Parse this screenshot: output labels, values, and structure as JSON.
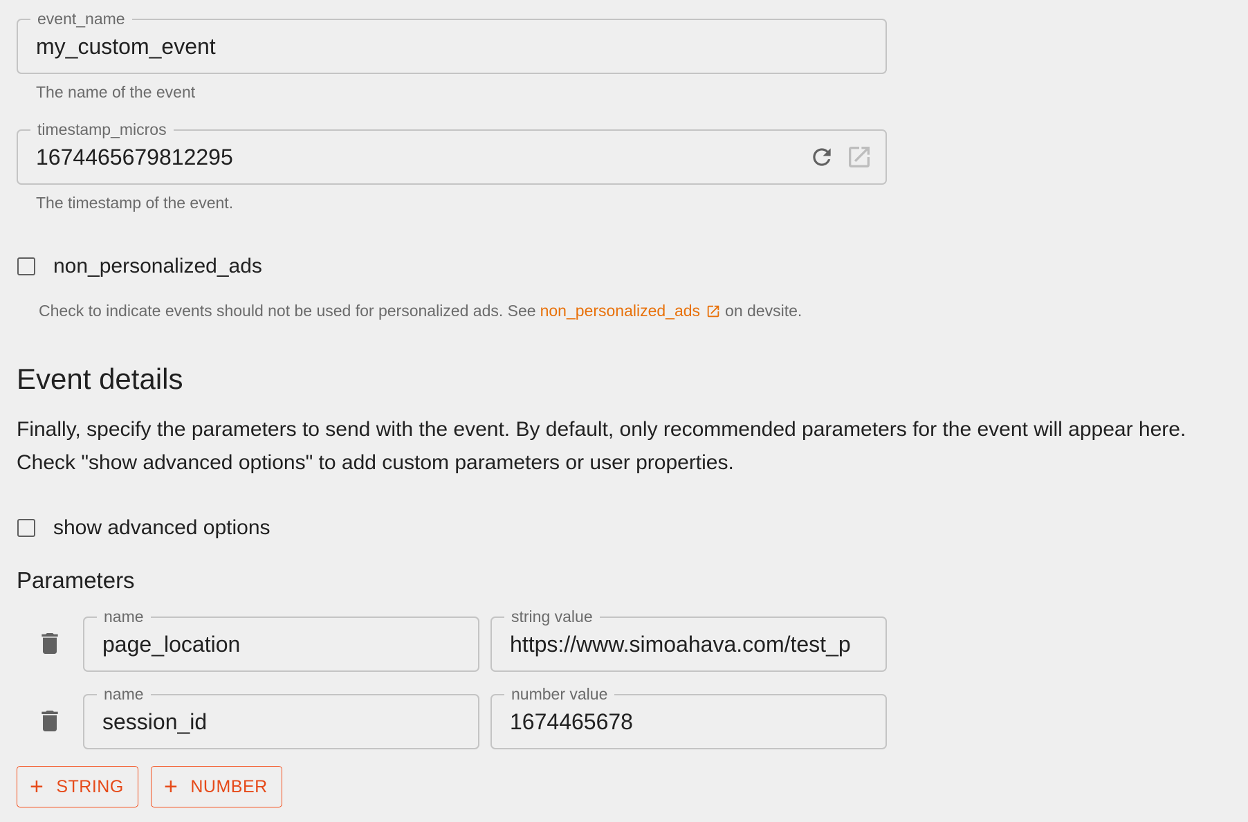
{
  "event_name_field": {
    "label": "event_name",
    "value": "my_custom_event",
    "helper": "The name of the event"
  },
  "timestamp_field": {
    "label": "timestamp_micros",
    "value": "1674465679812295",
    "helper": "The timestamp of the event.",
    "icons": [
      "refresh-icon",
      "open-in-new-icon"
    ]
  },
  "non_personalized_ads": {
    "label": "non_personalized_ads",
    "checked": false,
    "helper_prefix": "Check to indicate events should not be used for personalized ads. See",
    "helper_link": "non_personalized_ads",
    "helper_suffix": "on devsite."
  },
  "event_details": {
    "title": "Event details",
    "description": "Finally, specify the parameters to send with the event. By default, only recommended parameters for the event will appear here. Check \"show advanced options\" to add custom parameters or user properties."
  },
  "advanced_options": {
    "label": "show advanced options",
    "checked": false
  },
  "parameters": {
    "title": "Parameters",
    "rows": [
      {
        "name_label": "name",
        "name_value": "page_location",
        "value_label": "string value",
        "value": "https://www.simoahava.com/test_p"
      },
      {
        "name_label": "name",
        "name_value": "session_id",
        "value_label": "number value",
        "value": "1674465678"
      }
    ]
  },
  "buttons": {
    "add_string": "STRING",
    "add_number": "NUMBER"
  },
  "colors": {
    "background": "#efefef",
    "accent": "#e64a19",
    "link": "#e8710a"
  }
}
